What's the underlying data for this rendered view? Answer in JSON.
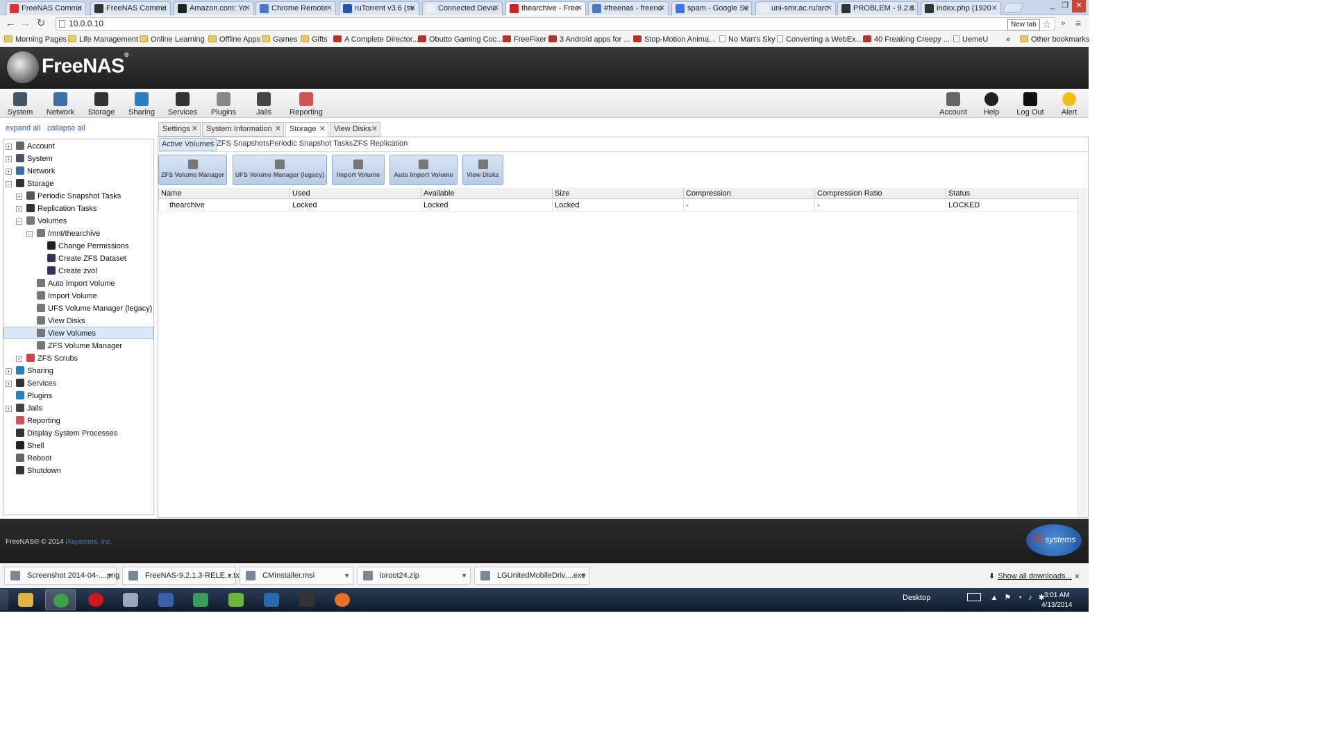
{
  "browser": {
    "tabs": [
      {
        "label": "FreeNAS Commu",
        "icon": "gmail-icon",
        "color": "#d33"
      },
      {
        "label": "FreeNAS Commu",
        "icon": "freenas-icon",
        "color": "#333"
      },
      {
        "label": "Amazon.com: Yo",
        "icon": "amazon-icon",
        "color": "#222"
      },
      {
        "label": "Chrome Remote",
        "icon": "remote-icon",
        "color": "#4a78c2"
      },
      {
        "label": "ruTorrent v3.6 (sv",
        "icon": "torrent-icon",
        "color": "#2255aa"
      },
      {
        "label": "Connected Devic",
        "icon": "page-icon",
        "color": "#eee"
      },
      {
        "label": "thearchive - Free",
        "icon": "freenas-icon",
        "color": "#c22",
        "active": true
      },
      {
        "label": "#freenas - freeno",
        "icon": "irc-icon",
        "color": "#4a78c2"
      },
      {
        "label": "spam - Google Se",
        "icon": "google-icon",
        "color": "#3b77e8"
      },
      {
        "label": "uni-smr.ac.ru/arc",
        "icon": "page-icon",
        "color": "#eee"
      },
      {
        "label": "PROBLEM - 9.2.3.",
        "icon": "freenas-icon",
        "color": "#333"
      },
      {
        "label": "index.php (1920",
        "icon": "freenas-icon",
        "color": "#333"
      }
    ],
    "new_tab_tooltip": "New tab",
    "url": "10.0.0.10",
    "more_icon": "»",
    "menu_icon": "≡"
  },
  "bookmarks": [
    {
      "label": "Morning Pages",
      "type": "folder"
    },
    {
      "label": "Life Management",
      "type": "folder"
    },
    {
      "label": "Online Learning",
      "type": "folder"
    },
    {
      "label": "Offline Apps",
      "type": "folder"
    },
    {
      "label": "Games",
      "type": "folder"
    },
    {
      "label": "Gifts",
      "type": "folder"
    },
    {
      "label": "A Complete Director...",
      "type": "site"
    },
    {
      "label": "Obutto Gaming Coc...",
      "type": "site"
    },
    {
      "label": "FreeFixer",
      "type": "site"
    },
    {
      "label": "3 Android apps for ...",
      "type": "site"
    },
    {
      "label": "Stop-Motion Anima...",
      "type": "site"
    },
    {
      "label": "No Man's Sky",
      "type": "page"
    },
    {
      "label": "Converting a WebEx...",
      "type": "page"
    },
    {
      "label": "40 Freaking Creepy ...",
      "type": "site"
    },
    {
      "label": "UemeU",
      "type": "page"
    }
  ],
  "bookmarks_overflow": "»",
  "other_bookmarks": "Other bookmarks",
  "app": {
    "logo_text": "FreeNAS",
    "logo_reg": "®",
    "main_menu": [
      {
        "label": "System",
        "icon": "system-icon"
      },
      {
        "label": "Network",
        "icon": "network-icon"
      },
      {
        "label": "Storage",
        "icon": "storage-icon"
      },
      {
        "label": "Sharing",
        "icon": "sharing-icon"
      },
      {
        "label": "Services",
        "icon": "services-icon"
      },
      {
        "label": "Plugins",
        "icon": "plugins-icon"
      },
      {
        "label": "Jails",
        "icon": "jails-icon"
      },
      {
        "label": "Reporting",
        "icon": "reporting-icon"
      }
    ],
    "right_menu": [
      {
        "label": "Account",
        "icon": "account-icon"
      },
      {
        "label": "Help",
        "icon": "help-icon"
      },
      {
        "label": "Log Out",
        "icon": "logout-icon"
      },
      {
        "label": "Alert",
        "icon": "alert-icon"
      }
    ],
    "expand_all": "expand all",
    "collapse_all": "collapse all",
    "tree": [
      {
        "label": "Account",
        "level": 0,
        "toggle": "+"
      },
      {
        "label": "System",
        "level": 0,
        "toggle": "+"
      },
      {
        "label": "Network",
        "level": 0,
        "toggle": "+"
      },
      {
        "label": "Storage",
        "level": 0,
        "toggle": "-"
      },
      {
        "label": "Periodic Snapshot Tasks",
        "level": 1,
        "toggle": "+"
      },
      {
        "label": "Replication Tasks",
        "level": 1,
        "toggle": "+"
      },
      {
        "label": "Volumes",
        "level": 1,
        "toggle": "-"
      },
      {
        "label": "/mnt/thearchive",
        "level": 2,
        "toggle": "-"
      },
      {
        "label": "Change Permissions",
        "level": 3,
        "toggle": ""
      },
      {
        "label": "Create ZFS Dataset",
        "level": 3,
        "toggle": ""
      },
      {
        "label": "Create zvol",
        "level": 3,
        "toggle": ""
      },
      {
        "label": "Auto Import Volume",
        "level": 2,
        "toggle": ""
      },
      {
        "label": "Import Volume",
        "level": 2,
        "toggle": ""
      },
      {
        "label": "UFS Volume Manager (legacy)",
        "level": 2,
        "toggle": ""
      },
      {
        "label": "View Disks",
        "level": 2,
        "toggle": ""
      },
      {
        "label": "View Volumes",
        "level": 2,
        "toggle": "",
        "selected": true
      },
      {
        "label": "ZFS Volume Manager",
        "level": 2,
        "toggle": ""
      },
      {
        "label": "ZFS Scrubs",
        "level": 1,
        "toggle": "+"
      },
      {
        "label": "Sharing",
        "level": 0,
        "toggle": "+"
      },
      {
        "label": "Services",
        "level": 0,
        "toggle": "+"
      },
      {
        "label": "Plugins",
        "level": 0,
        "toggle": ""
      },
      {
        "label": "Jails",
        "level": 0,
        "toggle": "+"
      },
      {
        "label": "Reporting",
        "level": 0,
        "toggle": ""
      },
      {
        "label": "Display System Processes",
        "level": 0,
        "toggle": ""
      },
      {
        "label": "Shell",
        "level": 0,
        "toggle": ""
      },
      {
        "label": "Reboot",
        "level": 0,
        "toggle": ""
      },
      {
        "label": "Shutdown",
        "level": 0,
        "toggle": ""
      }
    ],
    "doc_tabs": [
      {
        "label": "Settings"
      },
      {
        "label": "System Information"
      },
      {
        "label": "Storage",
        "active": true
      },
      {
        "label": "View Disks"
      }
    ],
    "sub_tabs": [
      {
        "label": "Active Volumes",
        "active": true
      },
      {
        "label": "ZFS Snapshots"
      },
      {
        "label": "Periodic Snapshot Tasks"
      },
      {
        "label": "ZFS Replication"
      }
    ],
    "action_buttons": [
      {
        "label": "ZFS Volume Manager"
      },
      {
        "label": "UFS Volume Manager (legacy)"
      },
      {
        "label": "Import Volume"
      },
      {
        "label": "Auto Import Volume"
      },
      {
        "label": "View Disks"
      }
    ],
    "table": {
      "columns": [
        "Name",
        "Used",
        "Available",
        "Size",
        "Compression",
        "Compression Ratio",
        "Status"
      ],
      "rows": [
        [
          "thearchive",
          "Locked",
          "Locked",
          "Locked",
          "-",
          "-",
          "LOCKED"
        ]
      ]
    },
    "footer": {
      "copyright": "FreeNAS® © 2014",
      "company": "iXsystems, Inc.",
      "logo_ix": "iX",
      "logo_text": "systems"
    }
  },
  "downloads": {
    "items": [
      {
        "label": "Screenshot 2014-04-....png"
      },
      {
        "label": "FreeNAS-9.2.1.3-RELE....txz"
      },
      {
        "label": "CMInstaller.msi"
      },
      {
        "label": "ioroot24.zip"
      },
      {
        "label": "LGUnitedMobileDriv....exe"
      }
    ],
    "show_all": "Show all downloads...",
    "close": "×"
  },
  "taskbar": {
    "apps": [
      {
        "name": "explorer-icon",
        "color": "#e0b440"
      },
      {
        "name": "chrome-icon",
        "color": "#3aa04a",
        "open": true
      },
      {
        "name": "opera-icon",
        "color": "#cc1a1a"
      },
      {
        "name": "computer-icon",
        "color": "#9aa8b8"
      },
      {
        "name": "keepass-icon",
        "color": "#3b5fa8"
      },
      {
        "name": "network-tool-icon",
        "color": "#3a9a5a"
      },
      {
        "name": "clover-icon",
        "color": "#6ab53a"
      },
      {
        "name": "dolphin-icon",
        "color": "#2a6ab0"
      },
      {
        "name": "steam-icon",
        "color": "#333"
      },
      {
        "name": "firefox-icon",
        "color": "#e8702a"
      }
    ],
    "desktop_label": "Desktop",
    "time": "3:01 AM",
    "date": "4/13/2014"
  }
}
